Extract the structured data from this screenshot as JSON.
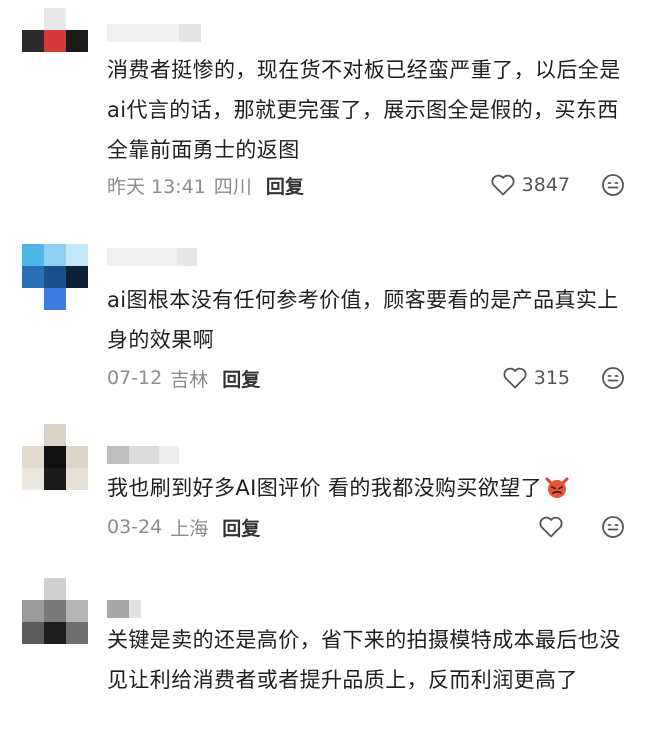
{
  "comments": [
    {
      "text": "消费者挺惨的，现在货不对板已经蛮严重了，以后全是ai代言的话，那就更完蛋了，展示图全是假的，买东西全靠前面勇士的返图",
      "time": "昨天 13:41",
      "location": "四川",
      "reply_label": "回复",
      "likes": "3847",
      "avatar_colors": [
        "#ffffff",
        "#e8e8e8",
        "#ffffff",
        "#2a2a2a",
        "#d43a3a",
        "#1c1c1c",
        "#ffffff",
        "#ffffff",
        "#ffffff"
      ],
      "name_colors": [
        "#f0f0f0",
        "#e4e4e4"
      ]
    },
    {
      "text": "ai图根本没有任何参考价值，顾客要看的是产品真实上身的效果啊",
      "time": "07-12",
      "location": "吉林",
      "reply_label": "回复",
      "likes": "315",
      "avatar_colors": [
        "#4bb7e8",
        "#8fd0f0",
        "#c2e6f7",
        "#2a6fb5",
        "#1a4f8c",
        "#0d1f3a",
        "#ffffff",
        "#3c7be0",
        "#ffffff"
      ],
      "name_colors": [
        "#f0f0f0",
        "#e6e6e6"
      ]
    },
    {
      "text": "我也刷到好多AI图评价 看的我都没购买欲望了",
      "time": "03-24",
      "location": "上海",
      "reply_label": "回复",
      "likes": "",
      "avatar_colors": [
        "#ffffff",
        "#d9d4c7",
        "#ffffff",
        "#e2dccf",
        "#111111",
        "#ddd7ca",
        "#ece7dc",
        "#1a1a1a",
        "#e6e0d4"
      ],
      "name_colors": [
        "#bdbdbd",
        "#dcdcdc",
        "#eeeeee"
      ]
    },
    {
      "text": "关键是卖的还是高价，省下来的拍摄模特成本最后也没见让利给消费者或者提升品质上，反而利润更高了",
      "avatar_colors": [
        "#ffffff",
        "#cfcfcf",
        "#ffffff",
        "#9a9a9a",
        "#7a7a7a",
        "#b5b5b5",
        "#5a5a5a",
        "#1e1e1e",
        "#6e6e6e"
      ],
      "name_colors": [
        "#a8a8a8",
        "#e2e2e2"
      ]
    }
  ]
}
